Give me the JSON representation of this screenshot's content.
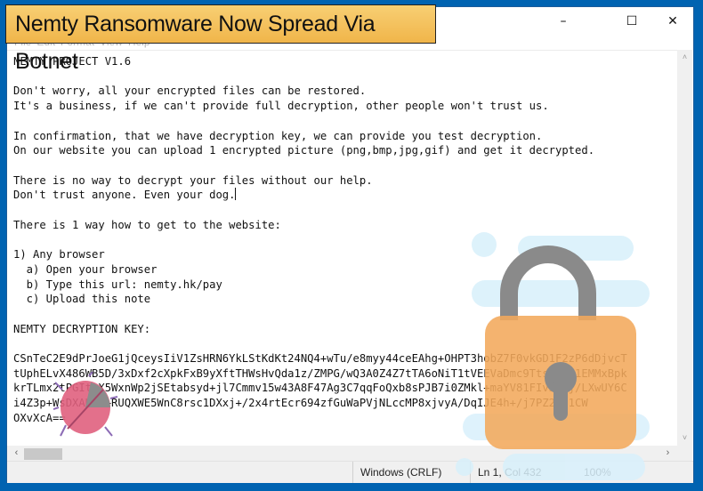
{
  "banner": {
    "title": "Nemty Ransomware Now Spread Via Botnet"
  },
  "window": {
    "controls": {
      "minimize": "–",
      "maximize": "☐",
      "close": "✕"
    }
  },
  "menubar": {
    "items": [
      "File",
      "Edit",
      "Format",
      "View",
      "Help"
    ]
  },
  "document": {
    "lines": [
      "NEMTY PROJECT V1.6",
      "",
      "Don't worry, all your encrypted files can be restored.",
      "It's a business, if we can't provide full decryption, other people won't trust us.",
      "",
      "In confirmation, that we have decryption key, we can provide you test decryption.",
      "On our website you can upload 1 encrypted picture (png,bmp,jpg,gif) and get it decrypted.",
      "",
      "There is no way to decrypt your files without our help.",
      "Don't trust anyone. Even your dog.",
      "",
      "There is 1 way how to get to the website:",
      "",
      "1) Any browser",
      "  a) Open your browser",
      "  b) Type this url: nemty.hk/pay",
      "  c) Upload this note",
      "",
      "NEMTY DECRYPTION KEY:",
      "",
      "CSnTeC2E9dPrJoeG1jQceysIiV1ZsHRN6YkLStKdKt24NQ4+wTu/e8myy44ceEAhg+OHPT3hobZ7F0vkGD1F2zP6dDjvcT",
      "tUphELvX486WB5D/3xDxf2cXpkFxB9yXftTHWsHvQda1z/ZMPG/wQ3A0Z4Z7tTA6oNiT1tVEEVaDmc9TtsJ7Ju1EMMxBpk",
      "krTLmx2tPGItzX5WxnWp2jSEtabsyd+jl7Cmmv15w43A8F47Ag3C7qqFoQxb8sPJB7i0ZMkl+maYV81FIv5CYj/LXwUY6C",
      "i4Z3p+WsDXAKE5+RUQXWE5WnC8rsc1DXxj+/2x4rtEcr694zfGuWaPVjNLccMP8xjvyA/DqIJE4h+/j7PZ2Oo1CW",
      "OXvXcA=="
    ]
  },
  "statusbar": {
    "encoding": "Windows (CRLF)",
    "position": "Ln 1, Col 432",
    "zoom": "100%"
  },
  "scrollbars": {
    "up_arrow": "˄",
    "down_arrow": "˅",
    "left_arrow": "‹",
    "right_arrow": "›"
  }
}
